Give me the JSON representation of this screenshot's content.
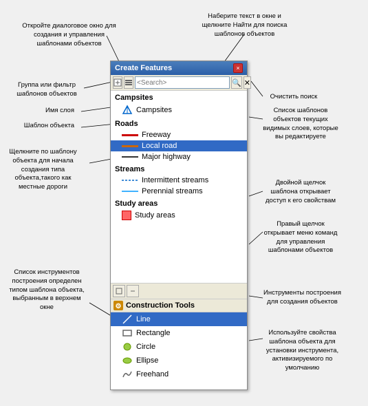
{
  "dialog": {
    "title": "Create Features",
    "close_label": "×",
    "search_placeholder": "<Search>"
  },
  "annotations": {
    "top_left": "Откройте диалоговое окно для создания\nи управления шаблонами объектов",
    "top_right": "Наберите текст в окне и\nщелкните Найти для\nпоиска шаблонов объектов",
    "clear_search": "Очистить поиск",
    "group_filter": "Группа или фильтр\nшаблонов объектов",
    "layer_name": "Имя слоя",
    "feature_template": "Шаблон объекта",
    "click_template": "Щелкните по шаблону\nобъекта для начала\nсоздания типа\nобъекта,такого как\nместные дороги",
    "template_list": "Список шаблонов\nобъектов текущих\nвидимых слоев,\nкоторые вы\nредактируете",
    "double_click": "Двойной щелчок\nшаблона открывает\nдоступ к его свойствам",
    "right_click": "Правый щелчок\nоткрывает меню\nкоманд для управления\nшаблонами объектов",
    "tools_list": "Список инструментов\nпостроения определен\nтипом шаблона\nобъекта,\nвыбранным в\nверхнем окне",
    "construction_tools": "Инструменты построения\nдля создания объектов",
    "template_props": "Используйте свойства\nшаблона объекта для\nустановки инструмента,\nактивизируемого по\nумолчанию"
  },
  "layers": [
    {
      "name": "Campsites",
      "items": [
        {
          "label": "Campsites",
          "icon": "tent"
        }
      ]
    },
    {
      "name": "Roads",
      "items": [
        {
          "label": "Freeway",
          "icon": "line-red"
        },
        {
          "label": "Local road",
          "icon": "line-local",
          "selected": true
        },
        {
          "label": "Major highway",
          "icon": "line-highway"
        }
      ]
    },
    {
      "name": "Streams",
      "items": [
        {
          "label": "Intermittent streams",
          "icon": "stream-dashed"
        },
        {
          "label": "Perennial streams",
          "icon": "stream-solid"
        }
      ]
    },
    {
      "name": "Study areas",
      "items": [
        {
          "label": "Study areas",
          "icon": "study-area"
        }
      ]
    }
  ],
  "construction_tools": {
    "header": "Construction Tools",
    "items": [
      {
        "label": "Line",
        "icon": "line-tool",
        "selected": true
      },
      {
        "label": "Rectangle",
        "icon": "rect-tool"
      },
      {
        "label": "Circle",
        "icon": "circle-tool"
      },
      {
        "label": "Ellipse",
        "icon": "ellipse-tool"
      },
      {
        "label": "Freehand",
        "icon": "freehand-tool"
      }
    ]
  }
}
